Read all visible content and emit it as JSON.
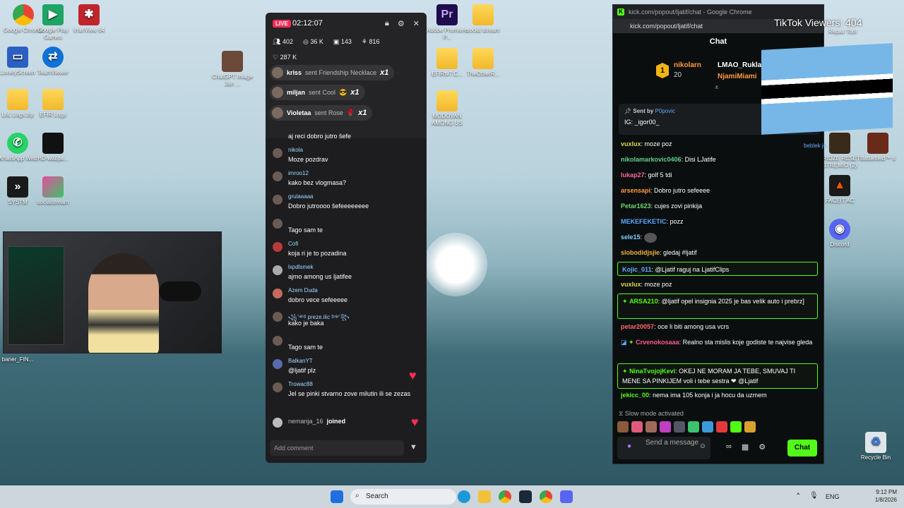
{
  "desktop_icons": [
    {
      "label": "Google Chrome",
      "x": 1
    },
    {
      "label": "Google Play Games",
      "x": 2
    },
    {
      "label": "IrfanView 64",
      "x": 3
    },
    {
      "label": "LonelyScreen"
    },
    {
      "label": "TeamViewer"
    },
    {
      "label": "LoL Logs.zip"
    },
    {
      "label": "EFIR Logs"
    },
    {
      "label": "WhatsApp Web"
    },
    {
      "label": "HD-wallpa..."
    },
    {
      "label": "SYSTM"
    },
    {
      "label": "socialstream"
    },
    {
      "label": "baner_FIN..."
    },
    {
      "label": "ChatGPT Image Jan ..."
    },
    {
      "label": "Adobe Premiere P..."
    },
    {
      "label": "social stream"
    },
    {
      "label": "EFIRtv7.C..."
    },
    {
      "label": "TheOtherR..."
    },
    {
      "label": "MODOVAN AMONG US"
    },
    {
      "label": "Repair Tool"
    },
    {
      "label": "FRIDZE RESET STREMIO (2)"
    },
    {
      "label": "Battlefield™ 6"
    },
    {
      "label": "FACEIT AC"
    },
    {
      "label": "Discord"
    },
    {
      "label": "Recycle Bin"
    }
  ],
  "tiktok": {
    "live": "LIVE",
    "time": "02:12:07",
    "stats": [
      "402",
      "36 K",
      "143",
      "816"
    ],
    "likes": "287 K",
    "gifts": [
      {
        "user": "kriss",
        "action": "sent Friendship Necklace",
        "count": "x1"
      },
      {
        "user": "miljan",
        "action": "sent Cool",
        "count": "x1"
      },
      {
        "user": "Violetaa",
        "action": "sent Rose",
        "count": "x1"
      }
    ],
    "messages": [
      {
        "user": "",
        "text": "aj reci dobro jutro šefe"
      },
      {
        "user": "nikola",
        "text": "Moze pozdrav"
      },
      {
        "user": "imroo12",
        "text": "kako bez vlogmasa?"
      },
      {
        "user": "grulaaaaa",
        "text": "Dobro jutroooo šefeeeeeeee"
      },
      {
        "user": "",
        "text": "Tago sam te"
      },
      {
        "user": "Cofi",
        "text": "koja ri je to pozadina"
      },
      {
        "user": "lxpdlsmek",
        "text": "ajmo among us ljatifee"
      },
      {
        "user": "Azem Duda",
        "text": "dobro vece sefeeeee"
      },
      {
        "user": "꧁༺ preze.ilic ༻꧂",
        "text": "kako je baka"
      },
      {
        "user": "",
        "text": "Tago sam te"
      },
      {
        "user": "BalkanYT",
        "text": "@ljatif plz"
      },
      {
        "user": "Trowac88",
        "text": "Jel se pinki stvarno zove milutin ili se zezas"
      }
    ],
    "joined_user": "nemanja_16",
    "joined_label": "joined",
    "input_placeholder": "Add comment"
  },
  "kick": {
    "window_title": "kick.com/popout/ljatif/chat - Google Chrome",
    "url": "kick.com/popout/ljatif/chat",
    "header": "Chat",
    "leader": {
      "rank": "1",
      "name": "nikolarn",
      "count": "20",
      "second": "LMAO_Rukla",
      "third": "NjamiMiami"
    },
    "pinned": {
      "sent_by_label": "Sent by",
      "sent_by": "P0povic",
      "text": "IG: _igor00_"
    },
    "messages": [
      {
        "user": "vuxlux",
        "color": "#d8d84a",
        "text": "moze poz"
      },
      {
        "user": "nikolamarkovic0406",
        "color": "#5fd38a",
        "text": "Disi LJatife"
      },
      {
        "user": "lukap27",
        "color": "#f26a9a",
        "text": "golf 5 tdi"
      },
      {
        "user": "arsensapi",
        "color": "#ff9a3c",
        "text": "Dobro jutro sefeeee"
      },
      {
        "user": "Petar1623",
        "color": "#6cd96c",
        "text": "cujes zovi pinkija"
      },
      {
        "user": "MEKEFEKETIC",
        "color": "#5aa9ff",
        "text": "pozz"
      },
      {
        "user": "sele15",
        "color": "#7fd1ff",
        "text": ""
      },
      {
        "user": "slobodidjsjie",
        "color": "#f0b23c",
        "text": "gledaj #ljatif"
      },
      {
        "user": "Kojic_011",
        "color": "#6ca8ff",
        "text": "@Ljatif raguj na LjatifClips"
      },
      {
        "user": "vuxlux",
        "color": "#d8d84a",
        "text": "moze poz"
      },
      {
        "user": "ARSA210",
        "color": "#53fc18",
        "text": "@ljatif opel insignia 2025 je bas velik auto i prebrz]"
      },
      {
        "user": "petar20057",
        "color": "#ff6a6a",
        "text": "oce li biti among usa vcrs"
      },
      {
        "user": "Crvenokosaaa",
        "color": "#ff5a8a",
        "text": "Realno sta mislis koje godiste te najvise gleda"
      },
      {
        "user": "NinaTvojojKevi",
        "color": "#53fc18",
        "text": "OKEJ NE MORAM JA TEBE, SMUVAJ TI MENE SA PINKIJEM voli i tebe sestra ❤ @Ljatif"
      },
      {
        "user": "jekicc_00",
        "color": "#53fc18",
        "text": "nema ima 105 konja i ja hocu da uzmem"
      }
    ],
    "slow_mode": "Slow mode activated",
    "input_placeholder": "Send a message",
    "send_label": "Chat",
    "side_tag": "beblek je..."
  },
  "overlay": {
    "tiktok_viewers": "TikTok Viewers: 404"
  },
  "taskbar": {
    "search": "Search",
    "lang": "ENG",
    "time": "9:12 PM",
    "date": "1/8/2026"
  }
}
